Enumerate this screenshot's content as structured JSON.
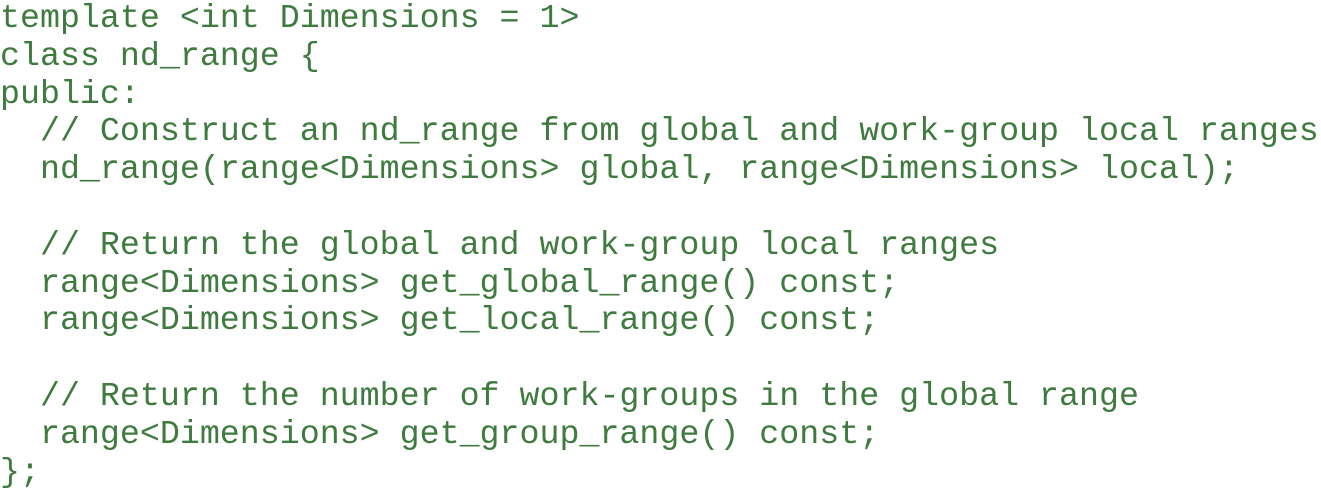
{
  "code": {
    "lines": [
      "template <int Dimensions = 1>",
      "class nd_range {",
      "public:",
      "  // Construct an nd_range from global and work-group local ranges",
      "  nd_range(range<Dimensions> global, range<Dimensions> local);",
      "",
      "  // Return the global and work-group local ranges",
      "  range<Dimensions> get_global_range() const;",
      "  range<Dimensions> get_local_range() const;",
      "",
      "  // Return the number of work-groups in the global range",
      "  range<Dimensions> get_group_range() const;",
      "};"
    ],
    "text_color": "#3f7a3f",
    "background_color": "#ffffff"
  }
}
